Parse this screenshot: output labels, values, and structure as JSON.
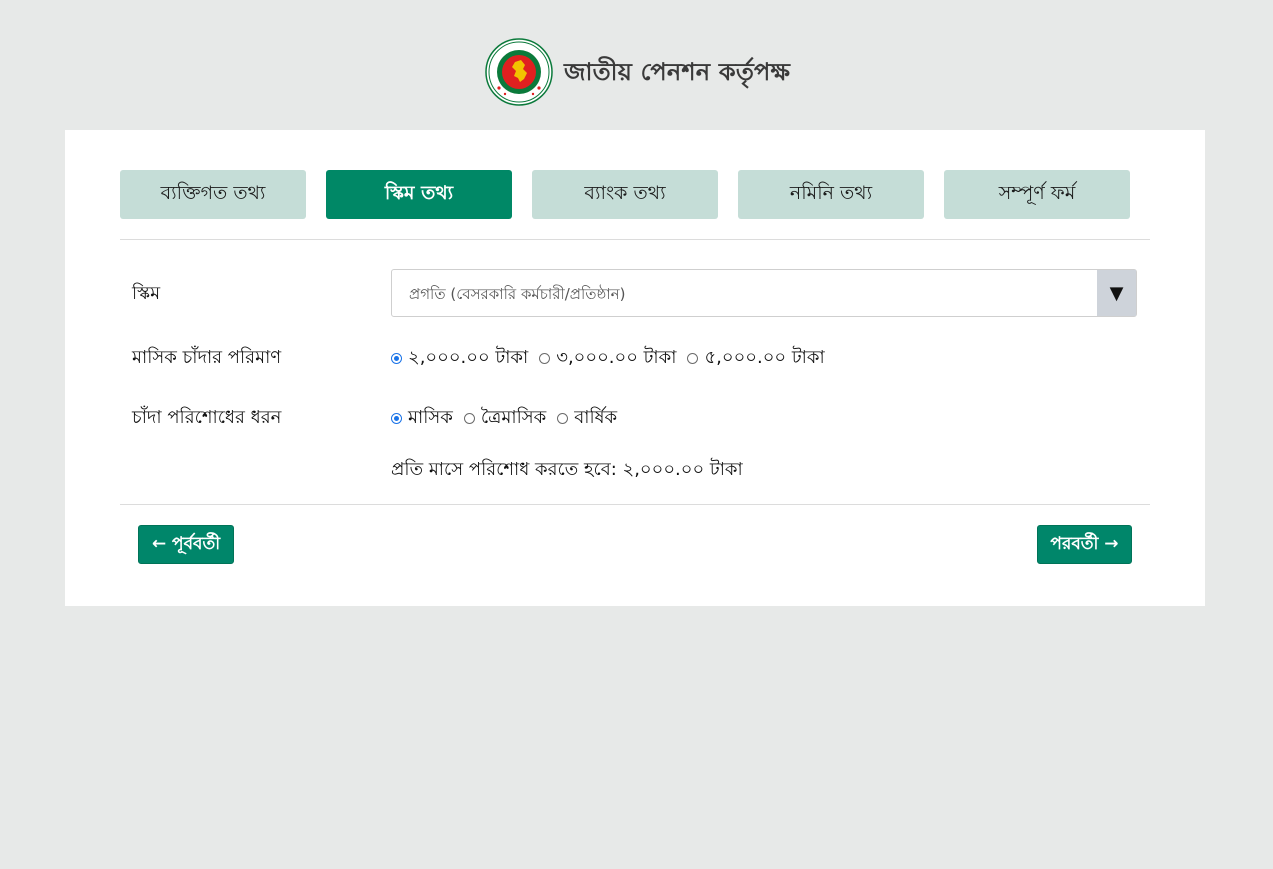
{
  "header": {
    "logo_ring_text_top": "গণপ্রজাতন্ত্রী বাংলাদেশ",
    "logo_ring_text_bottom": "সরকার",
    "title": "জাতীয় পেনশন কর্তৃপক্ষ"
  },
  "tabs": [
    {
      "label": "ব্যক্তিগত তথ্য",
      "active": false
    },
    {
      "label": "স্কিম তথ্য",
      "active": true
    },
    {
      "label": "ব্যাংক তথ্য",
      "active": false
    },
    {
      "label": "নমিনি তথ্য",
      "active": false
    },
    {
      "label": "সম্পূর্ণ ফর্ম",
      "active": false
    }
  ],
  "form": {
    "scheme": {
      "label": "স্কিম",
      "selected": "প্রগতি (বেসরকারি কর্মচারী/প্রতিষ্ঠান)",
      "arrow_icon": "▼"
    },
    "contribution": {
      "label": "মাসিক চাঁদার পরিমাণ",
      "options": [
        {
          "label": "২,০০০.০০ টাকা",
          "checked": true
        },
        {
          "label": "৩,০০০.০০ টাকা",
          "checked": false
        },
        {
          "label": "৫,০০০.০০ টাকা",
          "checked": false
        }
      ]
    },
    "payment_type": {
      "label": "চাঁদা পরিশোধের ধরন",
      "options": [
        {
          "label": "মাসিক",
          "checked": true
        },
        {
          "label": "ত্রৈমাসিক",
          "checked": false
        },
        {
          "label": "বার্ষিক",
          "checked": false
        }
      ]
    },
    "summary": "প্রতি মাসে পরিশোধ করতে হবে: ২,০০০.০০ টাকা"
  },
  "nav": {
    "prev_label": "← পূর্ববর্তী",
    "next_label": "পরবর্তী →"
  },
  "colors": {
    "page_bg": "#e7e9e8",
    "card_bg": "#ffffff",
    "tab_bg": "#c5ddd7",
    "tab_active_bg": "#008866",
    "button_bg": "#00866a",
    "radio_accent": "#1a73e8",
    "logo_green": "#0b7a3b",
    "logo_red": "#e02020"
  }
}
